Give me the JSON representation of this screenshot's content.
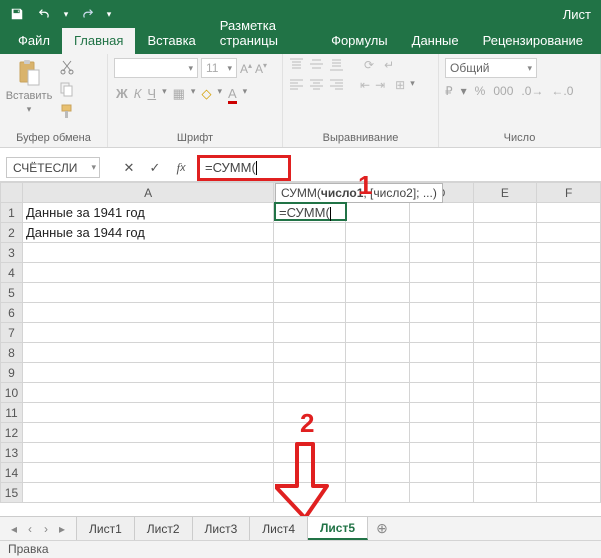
{
  "titlebar": {
    "doc": "Лист"
  },
  "tabs": {
    "file": "Файл",
    "home": "Главная",
    "insert": "Вставка",
    "layout": "Разметка страницы",
    "formulas": "Формулы",
    "data": "Данные",
    "review": "Рецензирование"
  },
  "ribbon": {
    "clipboard": {
      "paste": "Вставить",
      "label": "Буфер обмена"
    },
    "font": {
      "size": "11",
      "label": "Шрифт",
      "bold": "Ж",
      "italic": "К",
      "underline": "Ч"
    },
    "align": {
      "label": "Выравнивание"
    },
    "number": {
      "format": "Общий",
      "label": "Число"
    }
  },
  "namebox": "СЧЁТЕСЛИ",
  "formula": "=СУММ(",
  "tooltip": {
    "fn": "СУММ",
    "arg1": "число1",
    "rest": "; [число2]; ...)"
  },
  "cells": {
    "A1": "Данные за 1941 год",
    "A2": "Данные за 1944 год",
    "B1": "=СУММ("
  },
  "columns": [
    "A",
    "B",
    "C",
    "D",
    "E",
    "F"
  ],
  "rows": [
    "1",
    "2",
    "3",
    "4",
    "5",
    "6",
    "7",
    "8",
    "9",
    "10",
    "11",
    "12",
    "13",
    "14",
    "15"
  ],
  "sheets": [
    "Лист1",
    "Лист2",
    "Лист3",
    "Лист4",
    "Лист5"
  ],
  "active_sheet": "Лист5",
  "status": "Правка",
  "annotations": {
    "one": "1",
    "two": "2"
  }
}
